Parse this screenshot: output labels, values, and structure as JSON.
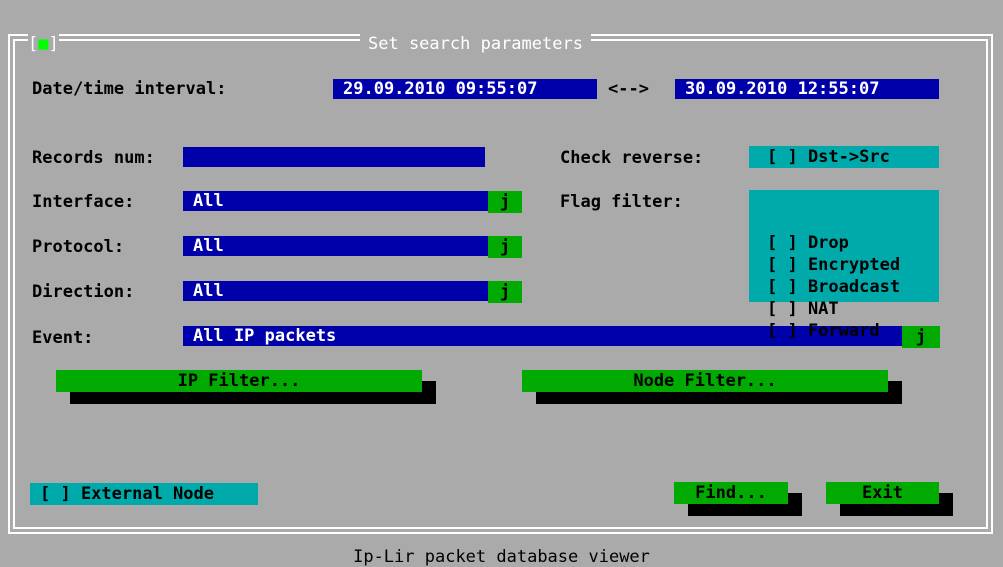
{
  "dialog": {
    "title": "Set search parameters",
    "close_left": "[",
    "close_glyph": "■",
    "close_right": "]"
  },
  "date_interval": {
    "label": "Date/time interval:",
    "from": "29.09.2010 09:55:07",
    "separator": "<-->",
    "to": "30.09.2010 12:55:07"
  },
  "records": {
    "label": "Records num:",
    "value": ""
  },
  "interface": {
    "label": "Interface:",
    "value": "All",
    "dropdown_glyph": "j"
  },
  "protocol": {
    "label": "Protocol:",
    "value": "All",
    "dropdown_glyph": "j"
  },
  "direction": {
    "label": "Direction:",
    "value": "All",
    "dropdown_glyph": "j"
  },
  "event": {
    "label": "Event:",
    "value": "All IP packets",
    "dropdown_glyph": "j"
  },
  "check_reverse": {
    "label": "Check reverse:",
    "option": "[ ] Dst->Src"
  },
  "flag_filter": {
    "label": "Flag filter:",
    "options": [
      "[ ] Drop",
      "[ ] Encrypted",
      "[ ] Broadcast",
      "[ ] NAT",
      "[ ] Forward"
    ]
  },
  "buttons": {
    "ip_filter": "IP Filter...",
    "node_filter": "Node Filter...",
    "find": "Find...",
    "exit": "Exit"
  },
  "external_node": "[ ] External Node",
  "status_bar": "Ip-Lir packet database viewer"
}
